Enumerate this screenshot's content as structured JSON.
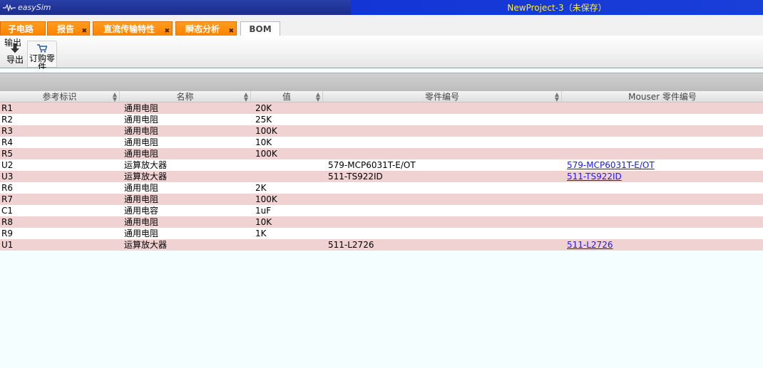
{
  "window": {
    "logo_text": "easySim",
    "title": "NewProject-3（未保存）"
  },
  "tabs": [
    {
      "label": "子电路",
      "closable": false
    },
    {
      "label": "报告",
      "closable": true
    },
    {
      "label": "直流传输特性",
      "closable": true
    },
    {
      "label": "瞬态分析",
      "closable": true
    },
    {
      "label": "BOM",
      "closable": false,
      "active": true
    }
  ],
  "toolbar": {
    "group_label": "输出",
    "export_label": "导出",
    "order_label": "订购零件"
  },
  "table": {
    "columns": [
      "参考标识",
      "名称",
      "值",
      "零件编号",
      "Mouser 零件编号"
    ],
    "rows": [
      {
        "ref": "R1",
        "name": "通用电阻",
        "value": "20K",
        "part": "",
        "mouser": ""
      },
      {
        "ref": "R2",
        "name": "通用电阻",
        "value": "25K",
        "part": "",
        "mouser": ""
      },
      {
        "ref": "R3",
        "name": "通用电阻",
        "value": "100K",
        "part": "",
        "mouser": ""
      },
      {
        "ref": "R4",
        "name": "通用电阻",
        "value": "10K",
        "part": "",
        "mouser": ""
      },
      {
        "ref": "R5",
        "name": "通用电阻",
        "value": "100K",
        "part": "",
        "mouser": ""
      },
      {
        "ref": "U2",
        "name": "运算放大器",
        "value": "",
        "part": "579-MCP6031T-E/OT",
        "mouser": "579-MCP6031T-E/OT"
      },
      {
        "ref": "U3",
        "name": "运算放大器",
        "value": "",
        "part": "511-TS922ID",
        "mouser": "511-TS922ID"
      },
      {
        "ref": "R6",
        "name": "通用电阻",
        "value": "2K",
        "part": "",
        "mouser": ""
      },
      {
        "ref": "R7",
        "name": "通用电阻",
        "value": "100K",
        "part": "",
        "mouser": ""
      },
      {
        "ref": "C1",
        "name": "通用电容",
        "value": "1uF",
        "part": "",
        "mouser": ""
      },
      {
        "ref": "R8",
        "name": "通用电阻",
        "value": "10K",
        "part": "",
        "mouser": ""
      },
      {
        "ref": "R9",
        "name": "通用电阻",
        "value": "1K",
        "part": "",
        "mouser": ""
      },
      {
        "ref": "U1",
        "name": "运算放大器",
        "value": "",
        "part": "511-L2726",
        "mouser": "511-L2726"
      }
    ]
  }
}
